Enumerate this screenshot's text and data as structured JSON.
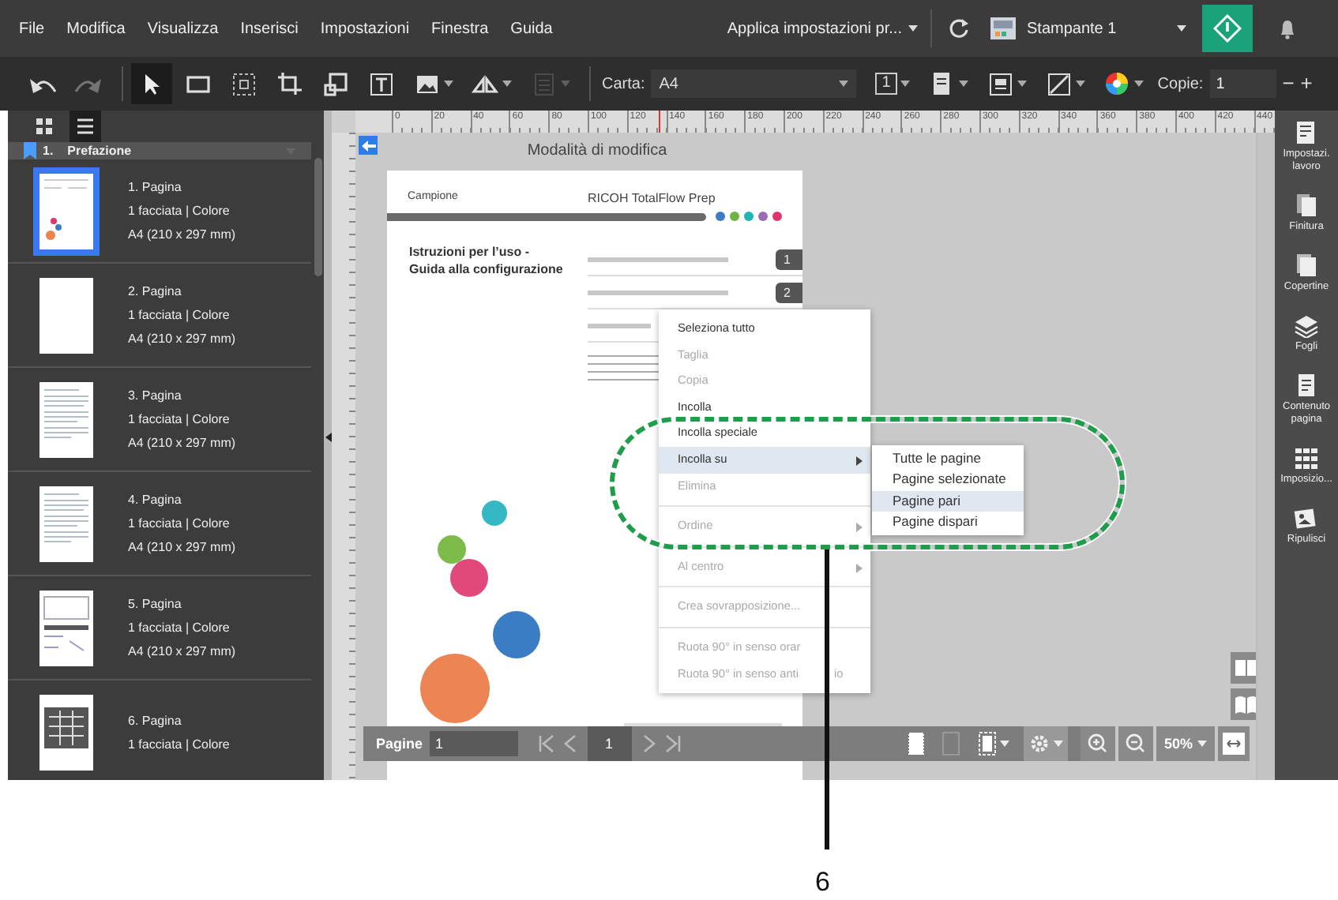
{
  "menu_bar": {
    "items": [
      "File",
      "Modifica",
      "Visualizza",
      "Inserisci",
      "Impostazioni",
      "Finestra",
      "Guida"
    ],
    "preset": "Applica impostazioni pr...",
    "printer": "Stampante 1"
  },
  "toolbar": {
    "tools": [
      {
        "kind": "undo",
        "selected": false,
        "disabled": false
      },
      {
        "kind": "redo",
        "selected": false,
        "disabled": true
      },
      {
        "kind": "pointer",
        "selected": true,
        "disabled": false
      },
      {
        "kind": "rectangle",
        "selected": false,
        "disabled": false
      },
      {
        "kind": "frame",
        "selected": false,
        "disabled": false
      },
      {
        "kind": "crop",
        "selected": false,
        "disabled": false
      },
      {
        "kind": "resize",
        "selected": false,
        "disabled": false
      },
      {
        "kind": "text",
        "selected": false,
        "disabled": false
      },
      {
        "kind": "image",
        "selected": false,
        "disabled": false
      },
      {
        "kind": "flip",
        "selected": false,
        "disabled": false
      },
      {
        "kind": "page",
        "selected": false,
        "disabled": true
      }
    ],
    "paper_label": "Carta:",
    "paper": "A4",
    "pages_per_sheet": "1",
    "copies_label": "Copie:",
    "copies": "1",
    "minus": "−",
    "plus": "+"
  },
  "view_modes": [
    {
      "kind": "grid",
      "selected": false
    },
    {
      "kind": "list",
      "selected": true
    }
  ],
  "section": {
    "number": "1.",
    "title": "Prefazione"
  },
  "pages": [
    {
      "title": "1. Pagina",
      "sides": "1 facciata | Colore",
      "size": "A4 (210 x 297 mm)",
      "kind": "cover",
      "selected": true
    },
    {
      "title": "2. Pagina",
      "sides": "1 facciata | Colore",
      "size": "A4 (210 x 297 mm)",
      "kind": "blank",
      "selected": false
    },
    {
      "title": "3. Pagina",
      "sides": "1 facciata | Colore",
      "size": "A4 (210 x 297 mm)",
      "kind": "text",
      "selected": false
    },
    {
      "title": "4. Pagina",
      "sides": "1 facciata | Colore",
      "size": "A4 (210 x 297 mm)",
      "kind": "text",
      "selected": false
    },
    {
      "title": "5. Pagina",
      "sides": "1 facciata | Colore",
      "size": "A4 (210 x 297 mm)",
      "kind": "figure",
      "selected": false
    },
    {
      "title": "6. Pagina",
      "sides": "1 facciata | Colore",
      "kind": "table",
      "selected": false
    }
  ],
  "canvas": {
    "ruler": [
      "0",
      "20",
      "40",
      "60",
      "80",
      "100",
      "120",
      "140",
      "160",
      "180",
      "200",
      "220",
      "240",
      "260",
      "280",
      "300",
      "320",
      "340",
      "360",
      "380",
      "400",
      "420",
      "440"
    ],
    "mode_title": "Modalità di modifica",
    "document": {
      "header_left": "Campione",
      "header_right": "RICOH TotalFlow Prep",
      "dots": [
        {
          "color": "#3b7dc4"
        },
        {
          "color": "#6db33f"
        },
        {
          "color": "#1fb3b3"
        },
        {
          "color": "#9b6bb5"
        },
        {
          "color": "#e0356b"
        }
      ],
      "title": "Istruzioni per l’uso -\nGuida alla configurazione",
      "tabs": [
        "1",
        "2"
      ]
    }
  },
  "context_menu": [
    {
      "kind": "item",
      "label": "Seleziona tutto",
      "disabled": false,
      "selected": false,
      "submenu": false
    },
    {
      "kind": "item",
      "label": "Taglia",
      "disabled": true,
      "selected": false,
      "submenu": false
    },
    {
      "kind": "item",
      "label": "Copia",
      "disabled": true,
      "selected": false,
      "submenu": false
    },
    {
      "kind": "item",
      "label": "Incolla",
      "disabled": false,
      "selected": false,
      "submenu": false
    },
    {
      "kind": "item",
      "label": "Incolla speciale",
      "disabled": false,
      "selected": false,
      "submenu": false
    },
    {
      "kind": "item",
      "label": "Incolla su",
      "disabled": false,
      "selected": true,
      "submenu": true
    },
    {
      "kind": "item",
      "label": "Elimina",
      "disabled": true,
      "selected": false,
      "submenu": false
    },
    {
      "kind": "separator"
    },
    {
      "kind": "item",
      "label": "Ordine",
      "disabled": true,
      "selected": false,
      "submenu": true
    },
    {
      "kind": "separator"
    },
    {
      "kind": "item",
      "label": "Al centro",
      "disabled": true,
      "selected": false,
      "submenu": true
    },
    {
      "kind": "separator"
    },
    {
      "kind": "item",
      "label": "Crea sovrapposizione...",
      "disabled": true,
      "selected": false,
      "submenu": false
    },
    {
      "kind": "separator"
    },
    {
      "kind": "item",
      "label": "Ruota 90° in senso orar",
      "disabled": true,
      "selected": false,
      "submenu": false
    },
    {
      "kind": "item",
      "label": "Ruota 90° in senso anti",
      "tail": "io",
      "disabled": true,
      "selected": false,
      "submenu": false
    }
  ],
  "submenu": [
    {
      "label": "Tutte le pagine",
      "selected": false
    },
    {
      "label": "Pagine selezionate",
      "selected": false
    },
    {
      "label": "Pagine pari",
      "selected": true
    },
    {
      "label": "Pagine dispari",
      "selected": false
    }
  ],
  "page_bar": {
    "label": "Pagine",
    "range": "1",
    "current": "1",
    "zoom": "50%"
  },
  "right_panel": [
    {
      "kind": "job",
      "label": "Impostazi.\nlavoro"
    },
    {
      "kind": "finishing",
      "label": "Finitura"
    },
    {
      "kind": "covers",
      "label": "Copertine"
    },
    {
      "kind": "sheets",
      "label": "Fogli"
    },
    {
      "kind": "content",
      "label": "Contenuto\npagina"
    },
    {
      "kind": "imposition",
      "label": "Imposizio..."
    },
    {
      "kind": "cleanup",
      "label": "Ripulisci"
    }
  ],
  "callout": {
    "label": "6"
  }
}
